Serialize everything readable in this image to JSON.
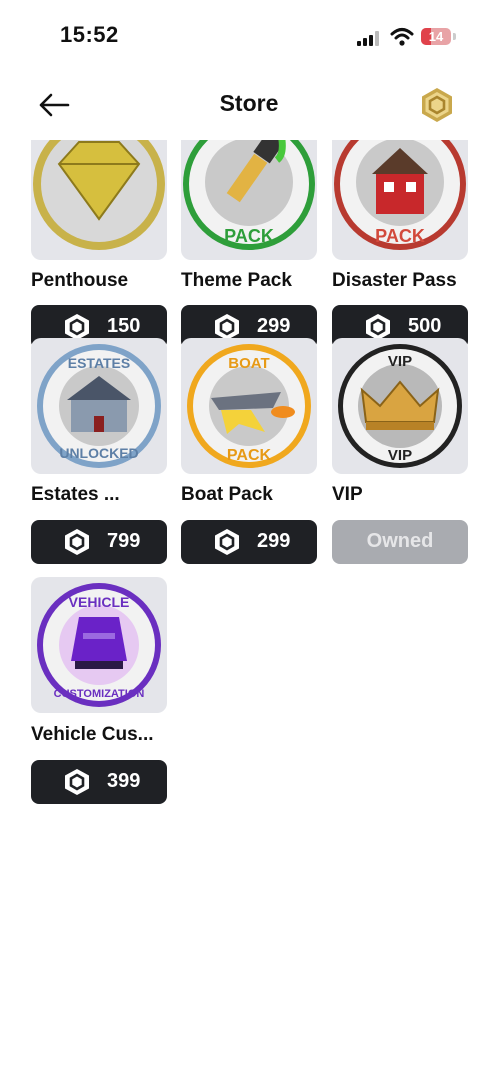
{
  "status_bar": {
    "time": "15:52",
    "battery": "14"
  },
  "header": {
    "title": "Store",
    "back_icon": "arrow-left-icon",
    "currency_icon": "robux-coin-icon"
  },
  "items": [
    {
      "name": "Penthouse",
      "price": "150",
      "icon": "diamond-icon"
    },
    {
      "name": "Theme Pack",
      "price": "299",
      "icon": "paintbrush-icon",
      "badge": "PACK"
    },
    {
      "name": "Disaster Pass",
      "price": "500",
      "icon": "house-icon",
      "badge": "PACK"
    },
    {
      "name": "Estates ...",
      "price": "799",
      "icon": "estate-house-icon",
      "badge_top": "ESTATES",
      "badge_bottom": "UNLOCKED"
    },
    {
      "name": "Boat Pack",
      "price": "299",
      "icon": "boat-icon",
      "badge_top": "BOAT",
      "badge_bottom": "PACK"
    },
    {
      "name": "VIP",
      "price": "Owned",
      "icon": "crown-icon",
      "badge_top": "VIP",
      "badge_bottom": "VIP"
    },
    {
      "name": "Vehicle Cus...",
      "price": "399",
      "icon": "car-icon",
      "badge_top": "VEHICLE",
      "badge_bottom": "CUSTOMIZATION"
    }
  ]
}
